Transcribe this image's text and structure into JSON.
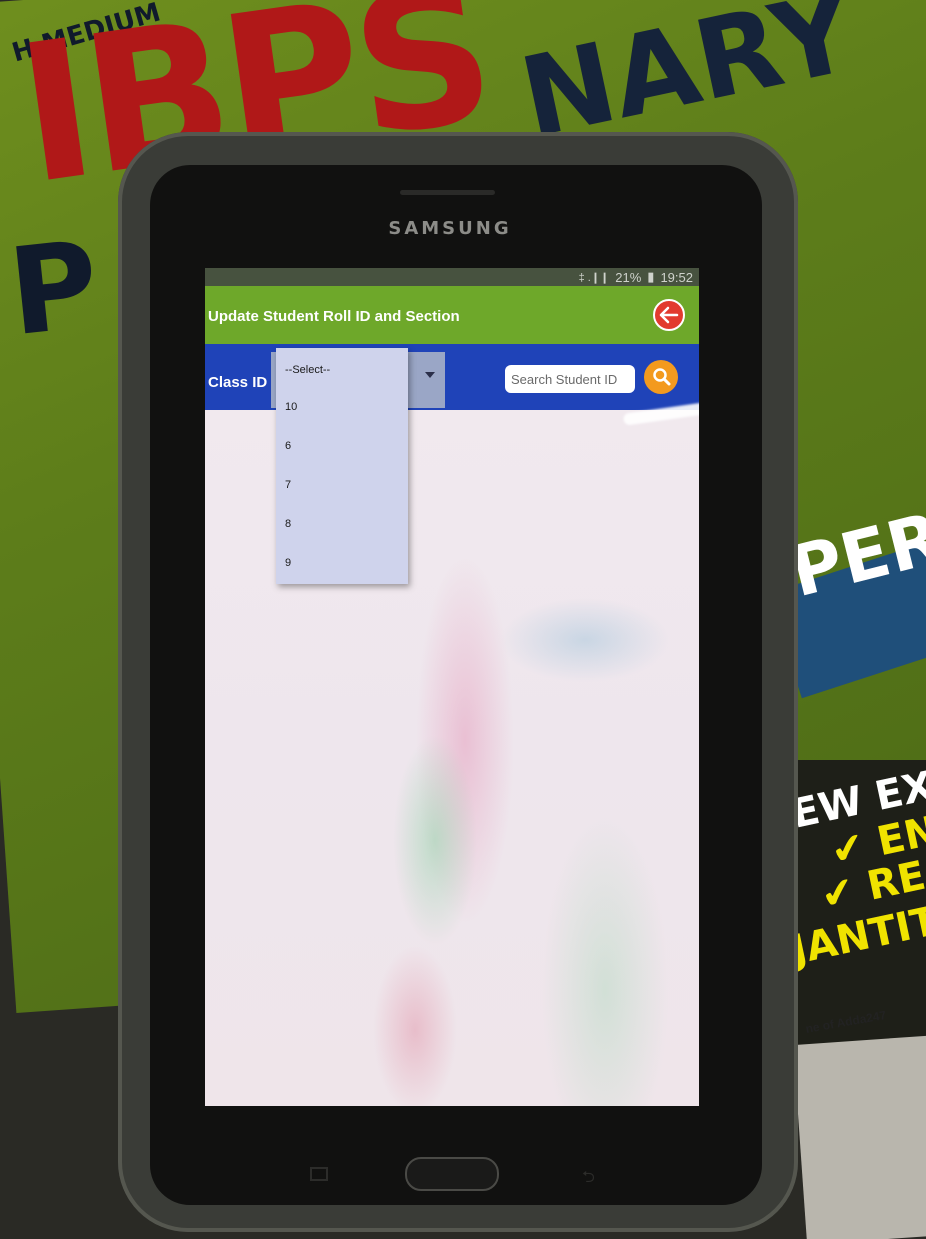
{
  "background": {
    "cover_words": [
      "IBPS",
      "NARY",
      "P",
      "PER",
      "H MEDIUM"
    ],
    "cover_lines": [
      "EW EXAM",
      "✔ ENG",
      "✔ REA",
      "JANTITA"
    ],
    "cover_small": "ne of Adda247"
  },
  "device": {
    "brand": "SAMSUNG"
  },
  "status_bar": {
    "signal": "‡ .❙❙",
    "battery": "21%",
    "time": "19:52"
  },
  "header": {
    "title": "Update Student Roll ID and Section"
  },
  "toolbar": {
    "class_label": "Class ID",
    "search_placeholder": "Search Student ID"
  },
  "class_dropdown": {
    "options": [
      "--Select--",
      "10",
      "6",
      "7",
      "8",
      "9"
    ]
  },
  "colors": {
    "titlebar": "#6ea82a",
    "toolbar": "#1f43b8",
    "back_button": "#e23b2f",
    "search_button": "#f39a1e",
    "dropdown_bg": "#cfd3ec"
  },
  "icons": {
    "back": "back-arrow-icon",
    "search": "search-icon",
    "caret": "caret-down-icon"
  }
}
